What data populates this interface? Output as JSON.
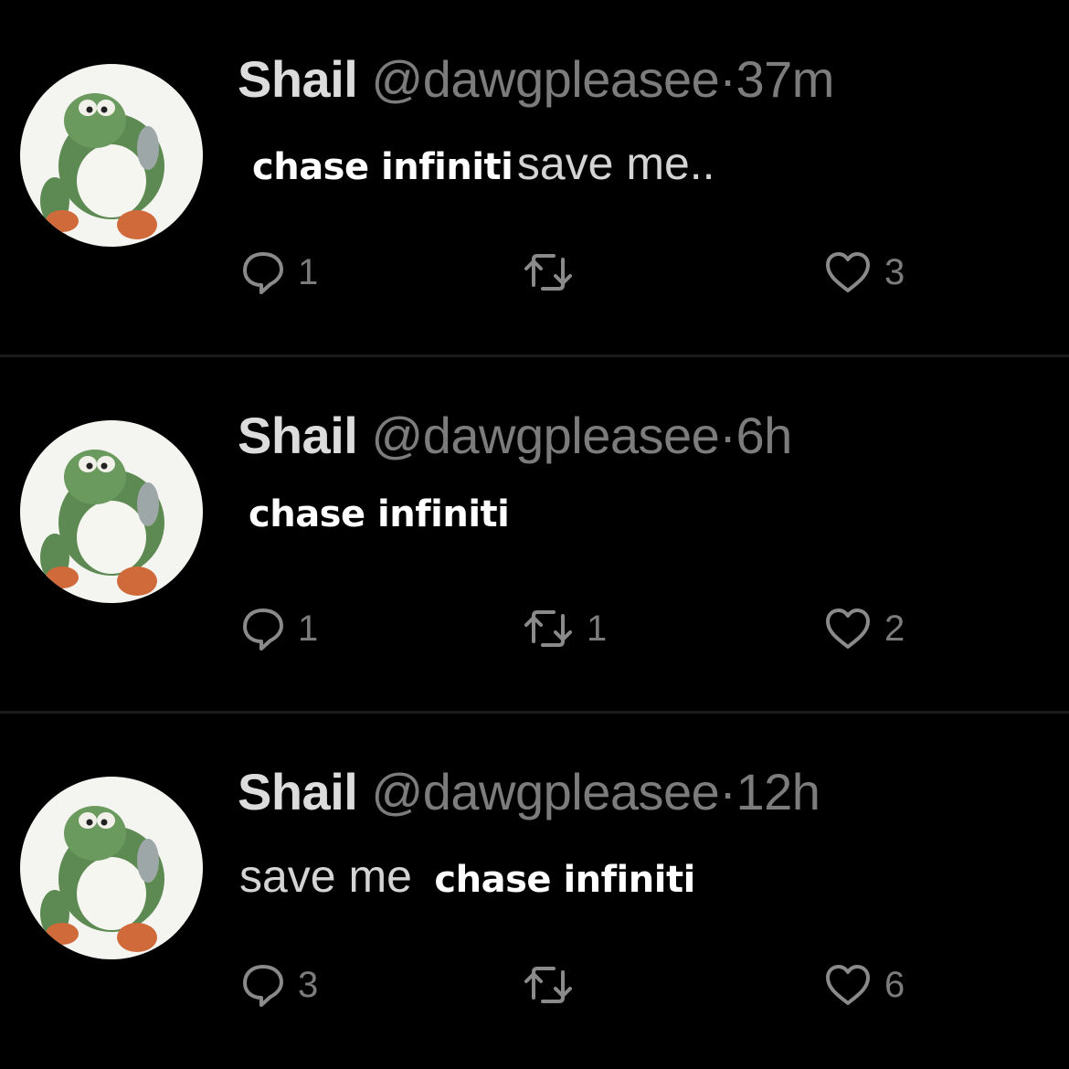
{
  "tweets": [
    {
      "author": "Shail",
      "handle": "@dawgpleasee",
      "separator": "·",
      "time": "37m",
      "text_bold": "chase infiniti",
      "text_plain": "save me..",
      "replies": "1",
      "retweets": "",
      "likes": "3"
    },
    {
      "author": "Shail",
      "handle": "@dawgpleasee",
      "separator": "·",
      "time": "6h",
      "text_bold": "chase infiniti",
      "text_plain": "",
      "replies": "1",
      "retweets": "1",
      "likes": "2"
    },
    {
      "author": "Shail",
      "handle": "@dawgpleasee",
      "separator": "·",
      "time": "12h",
      "text_plain": "save me",
      "text_bold": "chase infiniti",
      "replies": "3",
      "retweets": "",
      "likes": "6"
    }
  ],
  "icons": {
    "avatar": "green-dinosaur-avatar",
    "reply": "reply-icon",
    "retweet": "retweet-icon",
    "like": "heart-icon"
  },
  "colors": {
    "background": "#000000",
    "name": "#dcdcdc",
    "muted": "#7c7c7c",
    "overlay_text": "#ffffff"
  }
}
